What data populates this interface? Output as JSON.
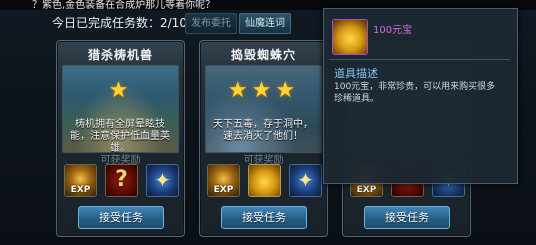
{
  "marquee": "？紫色,金色装备在合成炉那儿等着你呢？",
  "header": {
    "progress": "今日已完成任务数：2/10",
    "publish_btn": "发布委托",
    "fairy_btn": "仙魔连词"
  },
  "quests": [
    {
      "title": "猎杀梼机兽",
      "stars": "★",
      "description": "梼机拥有全屏晕眩技能，注意保护低血量英雄。",
      "reward_label": "可获奖励",
      "accept": "接受任务",
      "rewards": [
        {
          "icon": "exp-icon",
          "text": "EXP"
        },
        {
          "icon": "mystery-box-icon",
          "text": "?"
        },
        {
          "icon": "gem-icon",
          "text": "✦"
        }
      ]
    },
    {
      "title": "捣毁蜘蛛穴",
      "stars": "★★★",
      "description": "天下五毒，存于洞中，速去消灭了他们！",
      "reward_label": "可获奖励",
      "accept": "接受任务",
      "rewards": [
        {
          "icon": "exp-icon",
          "text": "EXP"
        },
        {
          "icon": "gold-ingot-icon",
          "text": ""
        },
        {
          "icon": "gem-icon",
          "text": "✦"
        }
      ]
    },
    {
      "title": "",
      "stars": "",
      "description": "",
      "reward_label": "",
      "accept": "接受任务",
      "rewards": [
        {
          "icon": "exp-icon",
          "text": "EXP"
        },
        {
          "icon": "mystery-box-icon",
          "text": ""
        },
        {
          "icon": "gem-icon",
          "text": "✦"
        }
      ]
    }
  ],
  "tooltip": {
    "item_name": "100元宝",
    "section_title": "道具描述",
    "description": "100元宝，非常珍贵，可以用来购买很多珍稀道具。",
    "icon": "gold-ingot-icon"
  },
  "colors": {
    "accent": "#3f86b8",
    "star": "#ffd23a",
    "item_rarity": "#d76ad6"
  }
}
